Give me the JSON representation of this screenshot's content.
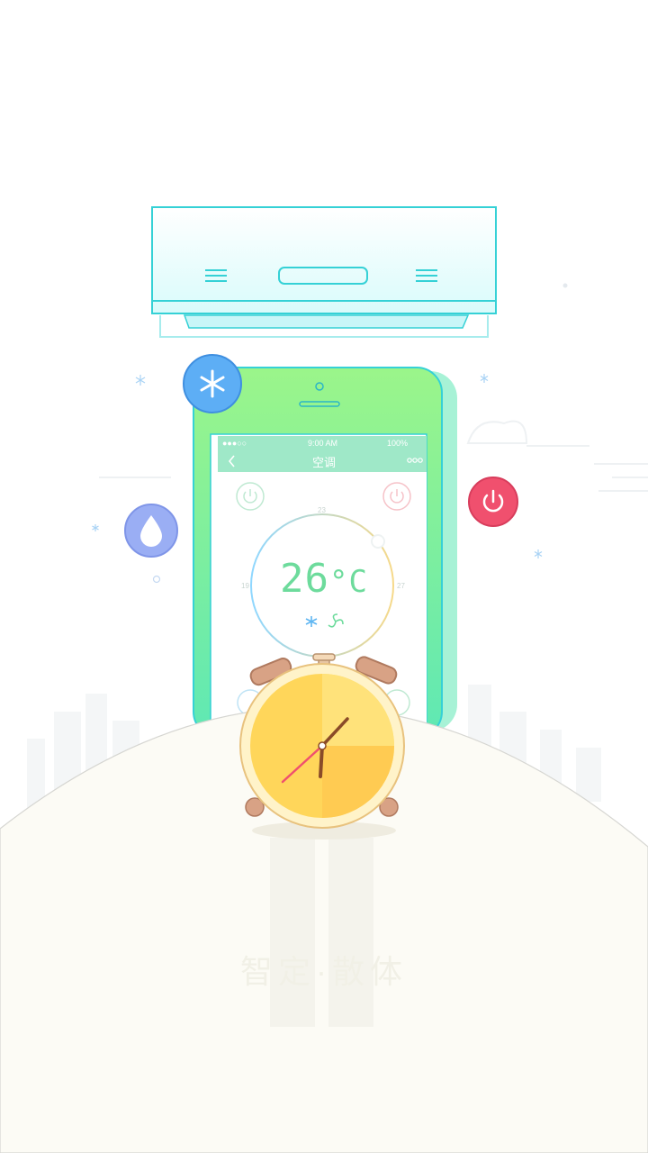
{
  "phone": {
    "status": {
      "signal": "●●●○○",
      "time": "9:00 AM",
      "battery": "100%"
    },
    "title": "空调",
    "back_icon": "chevron-left-icon",
    "more_icon": "more-dots-icon"
  },
  "thermostat": {
    "temperature": "26",
    "unit": "°C",
    "tick_min": "19",
    "tick_top": "23",
    "tick_max": "27",
    "mode_icons": [
      "snowflake-icon",
      "fan-icon"
    ]
  },
  "badges": {
    "cool": "snowflake-icon",
    "humidity": "water-drop-icon",
    "power": "power-icon"
  },
  "bottom_watermark": "智定·散体",
  "colors": {
    "phone_green": "#8ff28a",
    "ac_outline": "#35d1d6",
    "clock_yellow": "#ffd65a",
    "power_red": "#f0506e",
    "cool_blue": "#4aa8f2",
    "drop_purple": "#9aaef4",
    "temp_green": "#6ddb9c"
  }
}
